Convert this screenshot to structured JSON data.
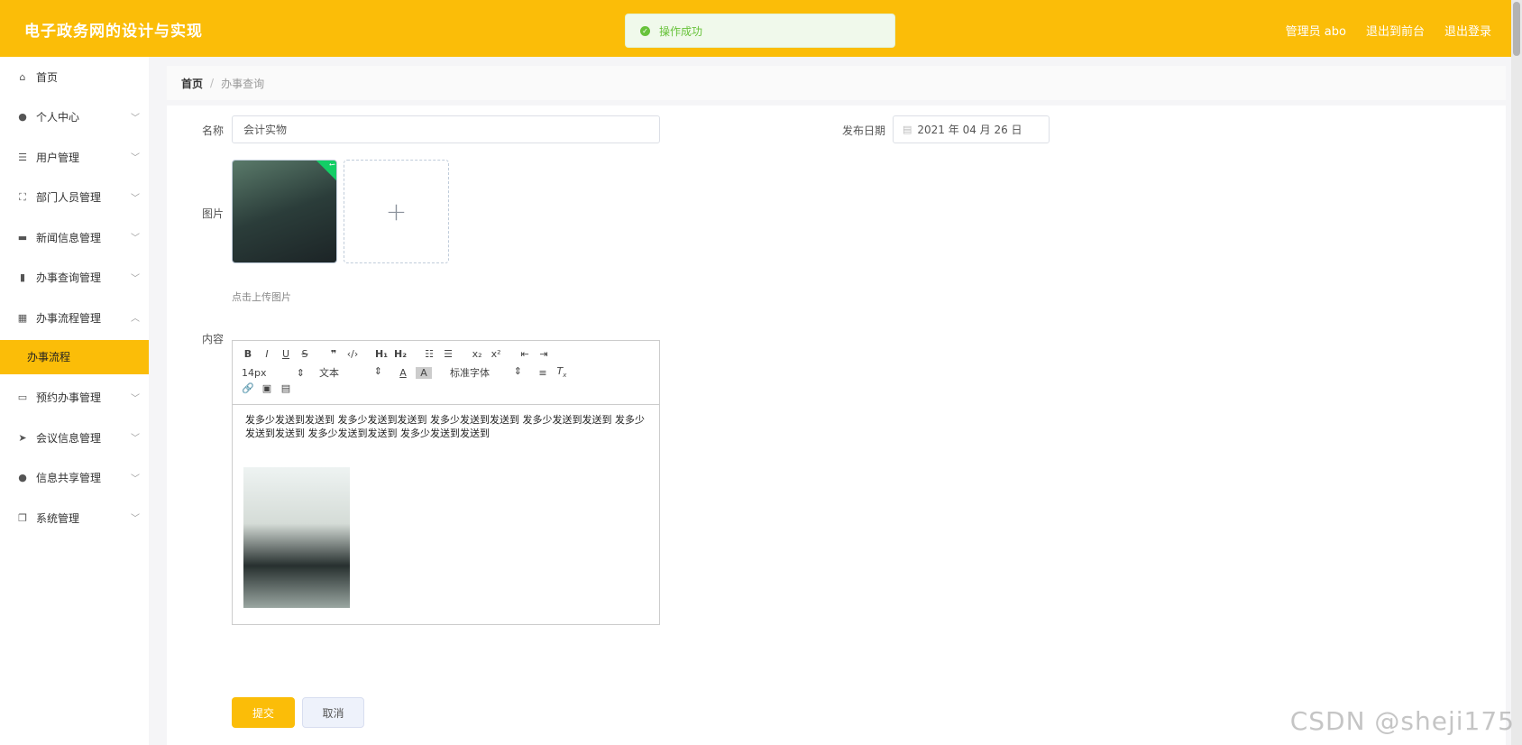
{
  "header": {
    "title": "电子政务网的设计与实现",
    "user_label": "管理员 abo",
    "back_front": "退出到前台",
    "logout": "退出登录",
    "bg_color": "#fbbd08"
  },
  "toast": {
    "message": "操作成功",
    "icon": "check-circle-icon"
  },
  "sidebar": {
    "items": [
      {
        "label": "首页",
        "icon": "home-icon"
      },
      {
        "label": "个人中心",
        "icon": "user-icon"
      },
      {
        "label": "用户管理",
        "icon": "list-icon"
      },
      {
        "label": "部门人员管理",
        "icon": "fullscreen-icon"
      },
      {
        "label": "新闻信息管理",
        "icon": "chat-icon"
      },
      {
        "label": "办事查询管理",
        "icon": "bar-chart-icon"
      },
      {
        "label": "办事流程管理",
        "icon": "grid-icon"
      },
      {
        "label": "预约办事管理",
        "icon": "monitor-icon"
      },
      {
        "label": "会议信息管理",
        "icon": "send-icon"
      },
      {
        "label": "信息共享管理",
        "icon": "user-icon"
      },
      {
        "label": "系统管理",
        "icon": "copy-icon"
      }
    ],
    "active_sub": "办事流程"
  },
  "breadcrumb": {
    "home": "首页",
    "current": "办事查询"
  },
  "form": {
    "name_label": "名称",
    "name_value": "会计实物",
    "date_label": "发布日期",
    "date_value": "2021 年 04 月 26 日",
    "image_label": "图片",
    "upload_hint": "点击上传图片",
    "content_label": "内容",
    "content_text": "发多少发送到发送到 发多少发送到发送到 发多少发送到发送到 发多少发送到发送到 发多少发送到发送到 发多少发送到发送到 发多少发送到发送到",
    "submit": "提交",
    "cancel": "取消"
  },
  "editor": {
    "font_size": "14px",
    "text_type": "文本",
    "font_family": "标准字体"
  },
  "watermark": "CSDN @sheji175"
}
